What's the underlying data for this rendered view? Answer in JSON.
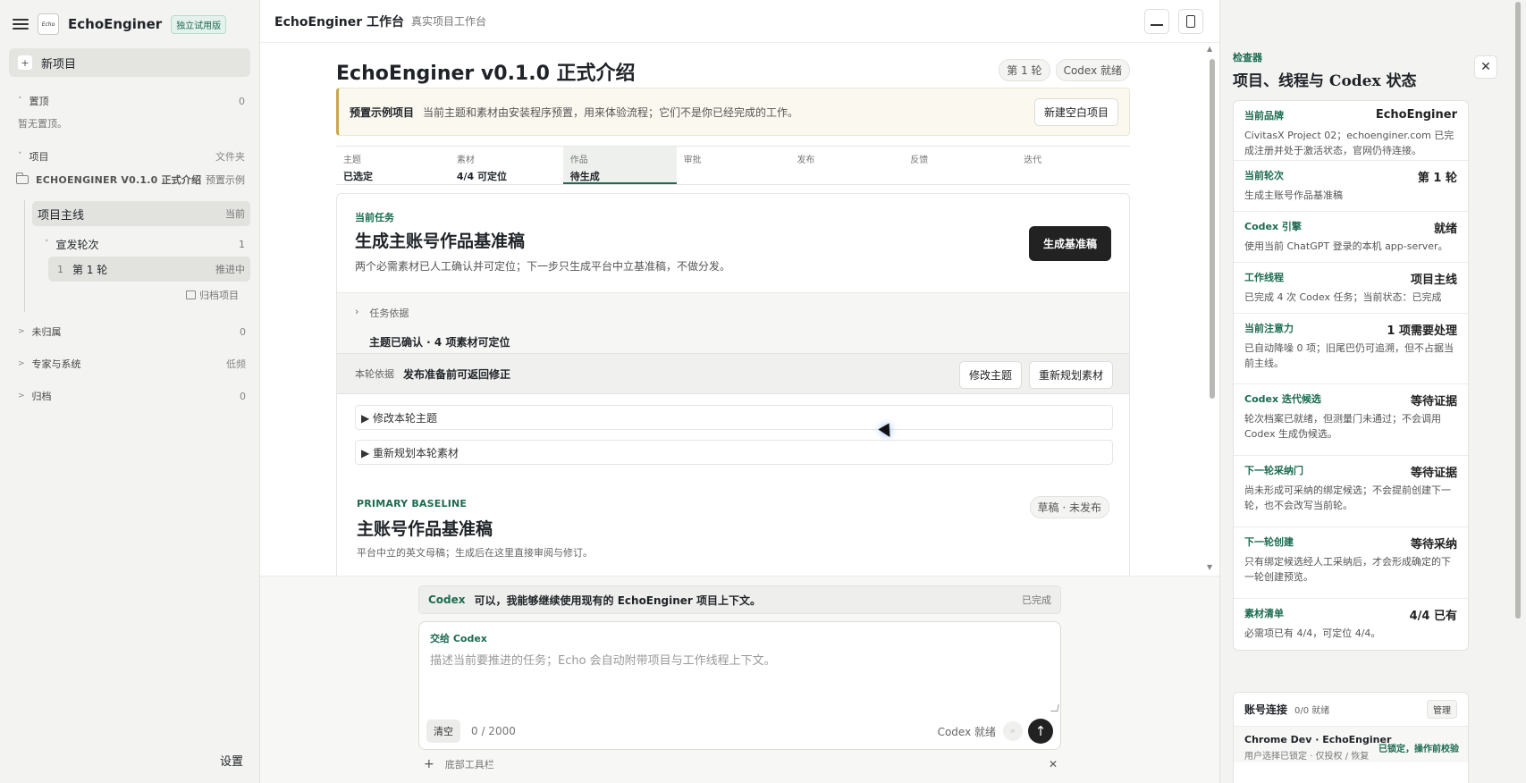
{
  "sidebar": {
    "brand": "EchoEnginer",
    "logo_text": "Echo",
    "trial_badge": "独立试用版",
    "new_project": "新项目",
    "pinned": {
      "label": "置顶",
      "count": "0",
      "empty": "暂无置顶。"
    },
    "projects": {
      "label": "项目",
      "action": "文件夹"
    },
    "project": {
      "name": "ECHOENGINER V0.1.0 正式介绍",
      "tag": "预置示例"
    },
    "main_line": {
      "label": "项目主线",
      "tag": "当前"
    },
    "round_group": {
      "label": "宣发轮次",
      "count": "1"
    },
    "round_item": {
      "index": "1",
      "label": "第 1 轮",
      "status": "推进中"
    },
    "archive_project": "归档项目",
    "unassigned": {
      "label": "未归属",
      "count": "0"
    },
    "experts": {
      "label": "专家与系统",
      "meta": "低频"
    },
    "archive": {
      "label": "归档",
      "count": "0"
    },
    "settings": "设置"
  },
  "header": {
    "title": "EchoEnginer 工作台",
    "subtitle": "真实项目工作台"
  },
  "doc": {
    "title": "EchoEnginer v0.1.0 正式介绍",
    "round_pill": "第 1 轮",
    "codex_pill": "Codex 就绪",
    "notice": {
      "title": "预置示例项目",
      "text": "当前主题和素材由安装程序预置，用来体验流程；它们不是你已经完成的工作。",
      "button": "新建空白项目"
    },
    "steps": [
      {
        "label": "主题",
        "value": "已选定"
      },
      {
        "label": "素材",
        "value": "4/4 可定位"
      },
      {
        "label": "作品",
        "value": "待生成"
      },
      {
        "label": "审批",
        "value": ""
      },
      {
        "label": "发布",
        "value": ""
      },
      {
        "label": "反馈",
        "value": ""
      },
      {
        "label": "迭代",
        "value": ""
      }
    ],
    "task": {
      "tag": "当前任务",
      "title": "生成主账号作品基准稿",
      "desc": "两个必需素材已人工确认并可定位；下一步只生成平台中立基准稿，不做分发。",
      "button": "生成基准稿"
    },
    "basis": {
      "label": "任务依据",
      "summary": "主题已确认 · 4 项素材可定位"
    },
    "round_basis": {
      "key": "本轮依据",
      "value": "发布准备前可返回修正",
      "btn_edit": "修改主题",
      "btn_replan": "重新规划素材"
    },
    "expand_edit": "▶ 修改本轮主题",
    "expand_replan": "▶ 重新规划本轮素材",
    "primary": {
      "tag": "PRIMARY BASELINE",
      "title": "主账号作品基准稿",
      "desc": "平台中立的英文母稿；生成后在这里直接审阅与修订。",
      "pill": "草稿 · 未发布"
    }
  },
  "composer": {
    "msg_who": "Codex",
    "msg_text": "可以，我能够继续使用现有的 EchoEnginer 项目上下文。",
    "msg_status": "已完成",
    "header": "交给 Codex",
    "placeholder": "描述当前要推进的任务；Echo 会自动附带项目与工作线程上下文。",
    "clear": "清空",
    "count": "0 / 2000",
    "ready": "Codex 就绪",
    "bottom_bar": "底部工具栏"
  },
  "inspector": {
    "tag": "检查器",
    "title": "项目、线程与 Codex 状态",
    "items": [
      {
        "k": "当前品牌",
        "v": "EchoEnginer",
        "d": "CivitasX Project 02；echoenginer.com 已完成注册并处于激活状态，官网仍待连接。"
      },
      {
        "k": "当前轮次",
        "v": "第 1 轮",
        "d": "生成主账号作品基准稿"
      },
      {
        "k": "Codex 引擎",
        "v": "就绪",
        "d": "使用当前 ChatGPT 登录的本机 app-server。"
      },
      {
        "k": "工作线程",
        "v": "项目主线",
        "d": "已完成 4 次 Codex 任务；当前状态：已完成"
      },
      {
        "k": "当前注意力",
        "v": "1 项需要处理",
        "d": "已自动降噪 0 项；旧尾巴仍可追溯，但不占据当前主线。"
      },
      {
        "k": "Codex 迭代候选",
        "v": "等待证据",
        "d": "轮次档案已就绪，但测量门未通过；不会调用 Codex 生成伪候选。"
      },
      {
        "k": "下一轮采纳门",
        "v": "等待证据",
        "d": "尚未形成可采纳的绑定候选；不会提前创建下一轮，也不会改写当前轮。"
      },
      {
        "k": "下一轮创建",
        "v": "等待采纳",
        "d": "只有绑定候选经人工采纳后，才会形成确定的下一轮创建预览。"
      },
      {
        "k": "素材清单",
        "v": "4/4 已有",
        "d": "必需项已有 4/4，可定位 4/4。"
      }
    ],
    "accounts": {
      "title": "账号连接",
      "count": "0/0 就绪",
      "manage": "管理",
      "row_name": "Chrome Dev · EchoEnginer",
      "row_sub": "用户选择已锁定 · 仅投权 / 恢复",
      "row_status": "已锁定，操作前校验"
    }
  },
  "colors": {
    "accent": "#1d6b52",
    "dark_button": "#222222",
    "notice_border": "#c9a84a"
  }
}
